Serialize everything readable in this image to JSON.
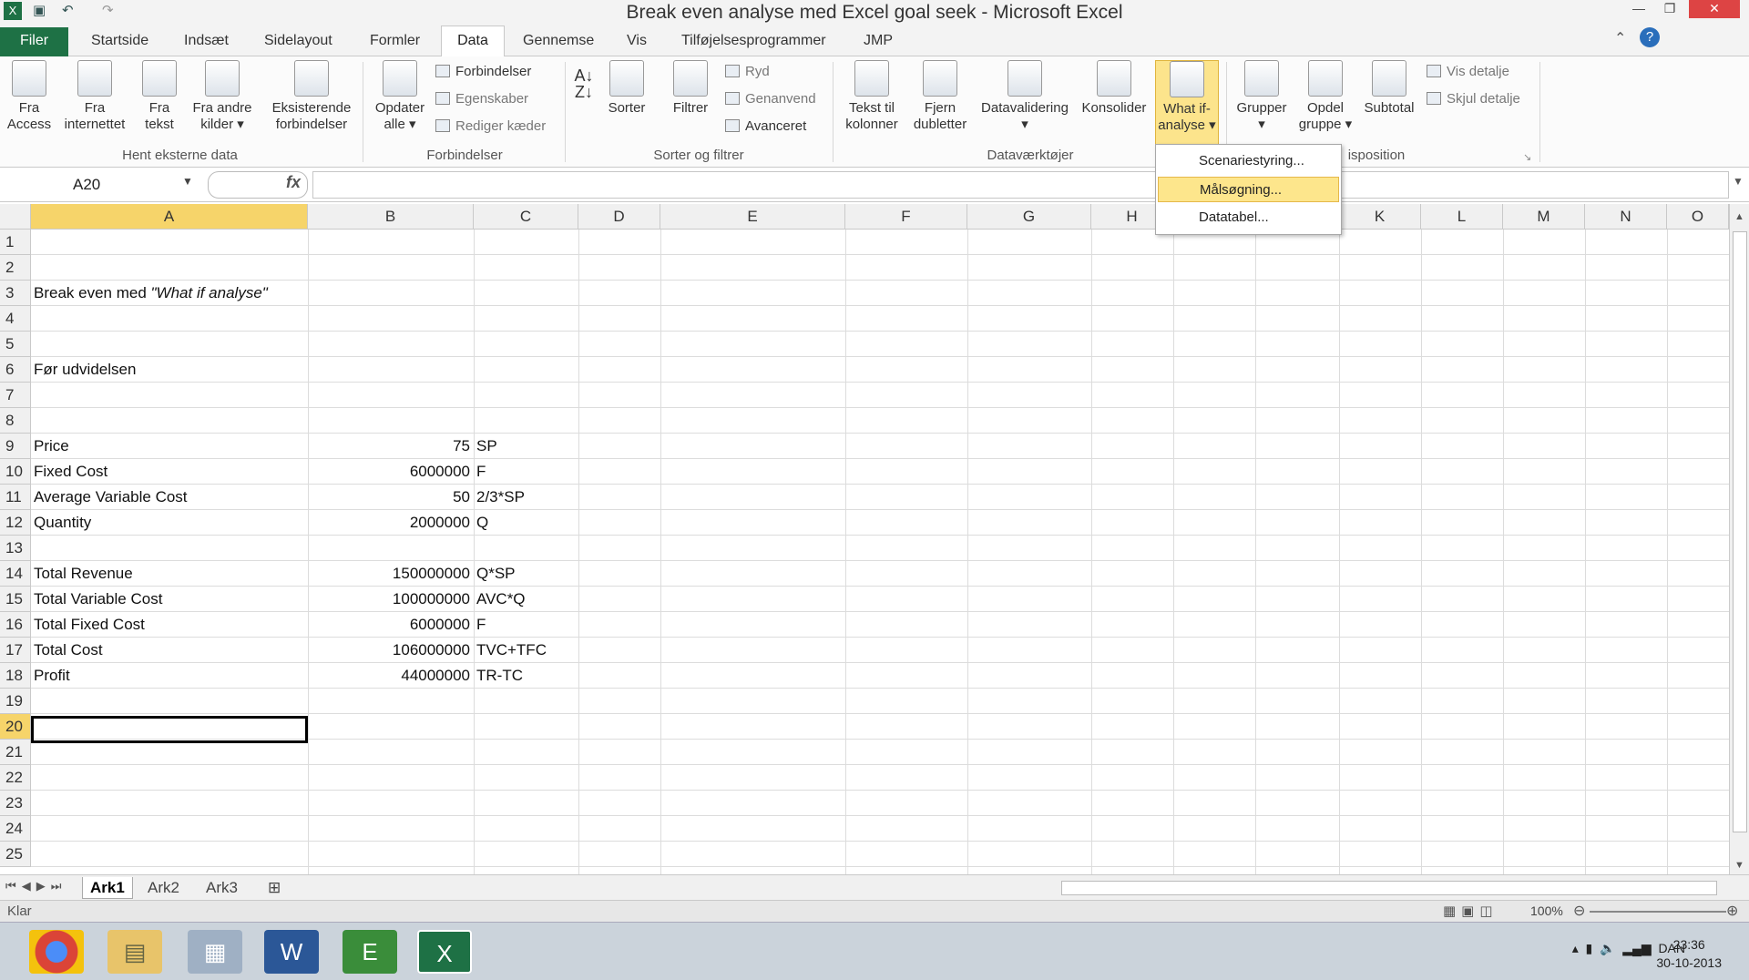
{
  "window": {
    "title": "Break even analyse med Excel goal seek - Microsoft Excel"
  },
  "tabs": [
    "Filer",
    "Startside",
    "Indsæt",
    "Sidelayout",
    "Formler",
    "Data",
    "Gennemse",
    "Vis",
    "Tilføjelsesprogrammer",
    "JMP"
  ],
  "ribbon": {
    "external": {
      "btn1": [
        "Fra",
        "Access"
      ],
      "btn2": [
        "Fra",
        "internettet"
      ],
      "btn3": [
        "Fra",
        "tekst"
      ],
      "btn4": [
        "Fra andre",
        "kilder"
      ],
      "btn5": [
        "Eksisterende",
        "forbindelser"
      ],
      "label": "Hent eksterne data"
    },
    "connections": {
      "refresh": [
        "Opdater",
        "alle"
      ],
      "links": "Forbindelser",
      "props": "Egenskaber",
      "edit": "Rediger kæder",
      "label": "Forbindelser"
    },
    "sort": {
      "sort": "Sorter",
      "filter": "Filtrer",
      "clear": "Ryd",
      "reapply": "Genanvend",
      "advanced": "Avanceret",
      "label": "Sorter og filtrer"
    },
    "tools": {
      "text": [
        "Tekst til",
        "kolonner"
      ],
      "dup": [
        "Fjern",
        "dubletter"
      ],
      "valid": "Datavalidering",
      "cons": "Konsolider",
      "whatif": [
        "What if-",
        "analyse"
      ],
      "label": "Dataværktøjer"
    },
    "outline": {
      "group": "Grupper",
      "ungroup": [
        "Opdel",
        "gruppe"
      ],
      "subtotal": "Subtotal",
      "show": "Vis detalje",
      "hide": "Skjul detalje",
      "label": "isposition"
    }
  },
  "dropdown": {
    "items": [
      "Scenariestyring...",
      "Målsøgning...",
      "Datatabel..."
    ]
  },
  "namebox": "A20",
  "columns": [
    "A",
    "B",
    "C",
    "D",
    "E",
    "F",
    "G",
    "H",
    "I",
    "J",
    "K",
    "L",
    "M",
    "N",
    "O"
  ],
  "rows": [
    "1",
    "2",
    "3",
    "4",
    "5",
    "6",
    "7",
    "8",
    "9",
    "10",
    "11",
    "12",
    "13",
    "14",
    "15",
    "16",
    "17",
    "18",
    "19",
    "20",
    "21",
    "22",
    "23",
    "24",
    "25"
  ],
  "cells": {
    "a3": "Break even med ",
    "a3i": "\"What if analyse\"",
    "a6": "Før udvidelsen",
    "a9": "Price",
    "b9": "75",
    "c9": "SP",
    "a10": "Fixed Cost",
    "b10": "6000000",
    "c10": "F",
    "a11": "Average Variable Cost",
    "b11": "50",
    "c11": "2/3*SP",
    "a12": "Quantity",
    "b12": "2000000",
    "c12": "Q",
    "a14": "Total Revenue",
    "b14": "150000000",
    "c14": "Q*SP",
    "a15": "Total Variable Cost",
    "b15": "100000000",
    "c15": "AVC*Q",
    "a16": "Total Fixed Cost",
    "b16": "6000000",
    "c16": "F",
    "a17": "Total Cost",
    "b17": "106000000",
    "c17": "TVC+TFC",
    "a18": "Profit",
    "b18": "44000000",
    "c18": "TR-TC"
  },
  "sheets": [
    "Ark1",
    "Ark2",
    "Ark3"
  ],
  "status": {
    "text": "Klar",
    "zoom": "100%"
  },
  "tray": {
    "lang": "DAN",
    "time": "23:36",
    "date": "30-10-2013"
  }
}
